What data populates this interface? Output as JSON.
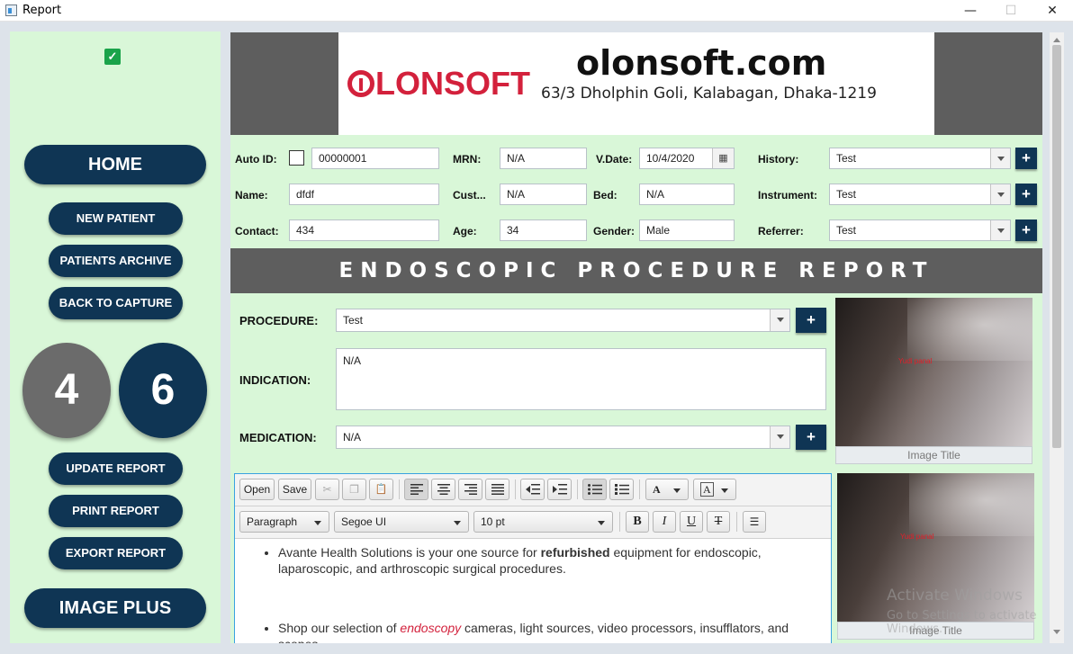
{
  "window": {
    "title": "Report",
    "minimize": "—",
    "maximize": "☐",
    "close": "✕"
  },
  "left": {
    "check": "✓",
    "home": "HOME",
    "new_patient": "NEW PATIENT",
    "patients_archive": "PATIENTS ARCHIVE",
    "back_to_capture": "BACK TO CAPTURE",
    "count_left": "4",
    "count_right": "6",
    "update_report": "UPDATE REPORT",
    "print_report": "PRINT REPORT",
    "export_report": "EXPORT REPORT",
    "image_plus": "IMAGE PLUS",
    "colors": {
      "nav": "#0f3554",
      "grey_circle": "#6b6b6b",
      "panel": "#d9f7d8"
    }
  },
  "header": {
    "logo_text": "LONSOFT",
    "site": "olonsoft.com",
    "address": "63/3 Dholphin Goli, Kalabagan, Dhaka-1219",
    "brand_color": "#d3213c"
  },
  "form": {
    "auto_id_label": "Auto ID:",
    "auto_id": "00000001",
    "mrn_label": "MRN:",
    "mrn": "N/A",
    "vdate_label": "V.Date:",
    "vdate": "10/4/2020",
    "history_label": "History:",
    "history": "Test",
    "name_label": "Name:",
    "name": "dfdf",
    "cust_label": "Cust...",
    "cust": "N/A",
    "bed_label": "Bed:",
    "bed": "N/A",
    "instrument_label": "Instrument:",
    "instrument": "Test",
    "contact_label": "Contact:",
    "contact": "434",
    "age_label": "Age:",
    "age": "34",
    "gender_label": "Gender:",
    "gender": "Male",
    "referrer_label": "Referrer:",
    "referrer": "Test",
    "plus": "+",
    "calendar_icon": "▦"
  },
  "report": {
    "title": "ENDOSCOPIC PROCEDURE REPORT",
    "procedure_label": "PROCEDURE:",
    "procedure": "Test",
    "indication_label": "INDICATION:",
    "indication": "N/A",
    "medication_label": "MEDICATION:",
    "medication": "N/A",
    "image_title_placeholder": "Image Title",
    "image_watermark": "Yudi panal"
  },
  "editor": {
    "open": "Open",
    "save": "Save",
    "cut_icon": "✂",
    "copy_icon": "❐",
    "paste_icon": "📋",
    "paragraph": "Paragraph",
    "font": "Segoe UI",
    "size": "10 pt",
    "bold": "B",
    "italic": "I",
    "underline": "U",
    "strike": "T",
    "hr_icon": "☰",
    "bullet1_pre": "Avante Health Solutions is your one source for ",
    "bullet1_bold": "refurbished",
    "bullet1_post": " equipment for endoscopic, laparoscopic, and arthroscopic surgical procedures.",
    "bullet2_pre": "Shop our selection of ",
    "bullet2_red": "endoscopy",
    "bullet2_post": " cameras, light sources, video processors, insufflators, and scopes."
  },
  "overlay": {
    "activate_title": "Activate Windows",
    "activate_sub": "Go to Settings to activate Windows."
  }
}
